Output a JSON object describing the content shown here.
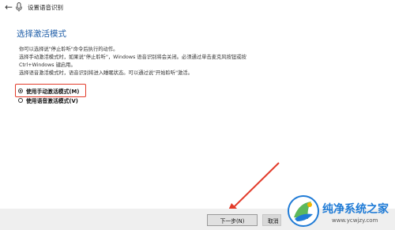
{
  "window": {
    "title": "设置语音识别"
  },
  "section": {
    "title": "选择激活模式"
  },
  "description": {
    "lines": [
      "你可以选择说\"停止聆听\"命令后执行的动作。",
      "选择手动激活模式时，如果说\"停止聆听\"，Windows 语音识别将会关闭。必须通过单击麦克风按钮或按",
      "Ctrl+Windows 键启用。",
      "选择语音激活模式时，语音识别将进入睡眠状态。可以通过说\"开始聆听\"激活。"
    ]
  },
  "options": [
    {
      "label": "使用手动激活模式(M)",
      "selected": true
    },
    {
      "label": "使用语音激活模式(V)",
      "selected": false
    }
  ],
  "buttons": {
    "next": "下一步(N)",
    "cancel": "取消"
  },
  "watermark": {
    "name": "纯净系统之家",
    "url": "www.ycwjzy.com"
  },
  "colors": {
    "accent": "#1f5ea8",
    "annotation": "#e23b2a",
    "brand": "#1f7bd6"
  }
}
